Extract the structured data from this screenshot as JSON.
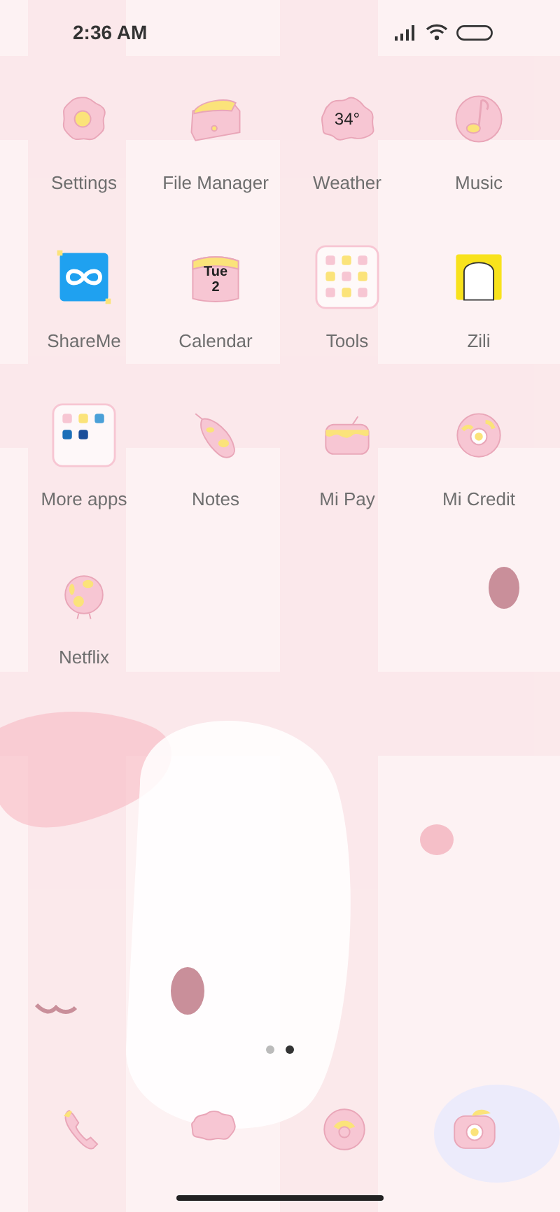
{
  "status_bar": {
    "time": "2:36 AM"
  },
  "apps": [
    {
      "label": "Settings",
      "kind": "app"
    },
    {
      "label": "File Manager",
      "kind": "app"
    },
    {
      "label": "Weather",
      "kind": "app",
      "icon_text": [
        "34°"
      ]
    },
    {
      "label": "Music",
      "kind": "app"
    },
    {
      "label": "ShareMe",
      "kind": "app"
    },
    {
      "label": "Calendar",
      "kind": "app",
      "icon_text": [
        "Tue",
        "2"
      ]
    },
    {
      "label": "Tools",
      "kind": "folder"
    },
    {
      "label": "Zili",
      "kind": "app"
    },
    {
      "label": "More apps",
      "kind": "folder"
    },
    {
      "label": "Notes",
      "kind": "app"
    },
    {
      "label": "Mi Pay",
      "kind": "app"
    },
    {
      "label": "Mi Credit",
      "kind": "app"
    },
    {
      "label": "Netflix",
      "kind": "app"
    }
  ],
  "pages": [
    {
      "selected": false
    },
    {
      "selected": true
    }
  ]
}
